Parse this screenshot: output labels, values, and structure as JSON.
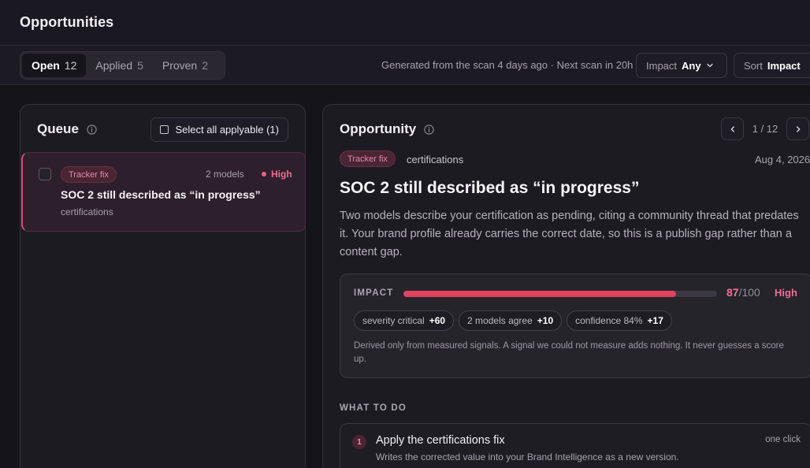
{
  "header": {
    "title": "Opportunities"
  },
  "toolbar": {
    "tabs": [
      {
        "label": "Open",
        "count": "12",
        "active": true
      },
      {
        "label": "Applied",
        "count": "5",
        "active": false
      },
      {
        "label": "Proven",
        "count": "2",
        "active": false
      }
    ],
    "scan_info": "Generated from the scan 4 days ago · Next scan in 20h",
    "impact_filter": {
      "label": "Impact",
      "value": "Any"
    },
    "sort": {
      "label": "Sort",
      "value": "Impact"
    }
  },
  "queue": {
    "title": "Queue",
    "select_all_label": "Select all applyable (1)",
    "items": [
      {
        "badge": "Tracker fix",
        "models": "2 models",
        "severity": "High",
        "title": "SOC 2 still described as “in progress”",
        "category": "certifications"
      }
    ]
  },
  "opportunity": {
    "title_label": "Opportunity",
    "pager": "1 / 12",
    "badge": "Tracker fix",
    "category": "certifications",
    "date": "Aug 4, 2026",
    "title": "SOC 2 still described as “in progress”",
    "description": "Two models describe your certification as pending, citing a community thread that predates it. Your brand profile already carries the correct date, so this is a publish gap rather than a content gap.",
    "impact": {
      "label": "IMPACT",
      "score": 87,
      "score_text": "87",
      "max_text": "/100",
      "level": "High",
      "chips": [
        {
          "label": "severity critical",
          "delta": "+60"
        },
        {
          "label": "2 models agree",
          "delta": "+10"
        },
        {
          "label": "confidence 84%",
          "delta": "+17"
        }
      ],
      "note": "Derived only from measured signals. A signal we could not measure adds nothing. It never guesses a score up."
    },
    "what_to_do": {
      "label": "WHAT TO DO",
      "steps": [
        {
          "number": "1",
          "title": "Apply the certifications fix",
          "description": "Writes the corrected value into your Brand Intelligence as a new version.",
          "tag": "one click"
        }
      ]
    }
  },
  "colors": {
    "accent": "#e0435e",
    "badge_text": "#e58aa6",
    "severity_high": "#ef6f92"
  },
  "icons": [
    "info-icon",
    "chevron-down-icon",
    "chevron-left-icon",
    "chevron-right-icon",
    "checkbox-icon"
  ]
}
